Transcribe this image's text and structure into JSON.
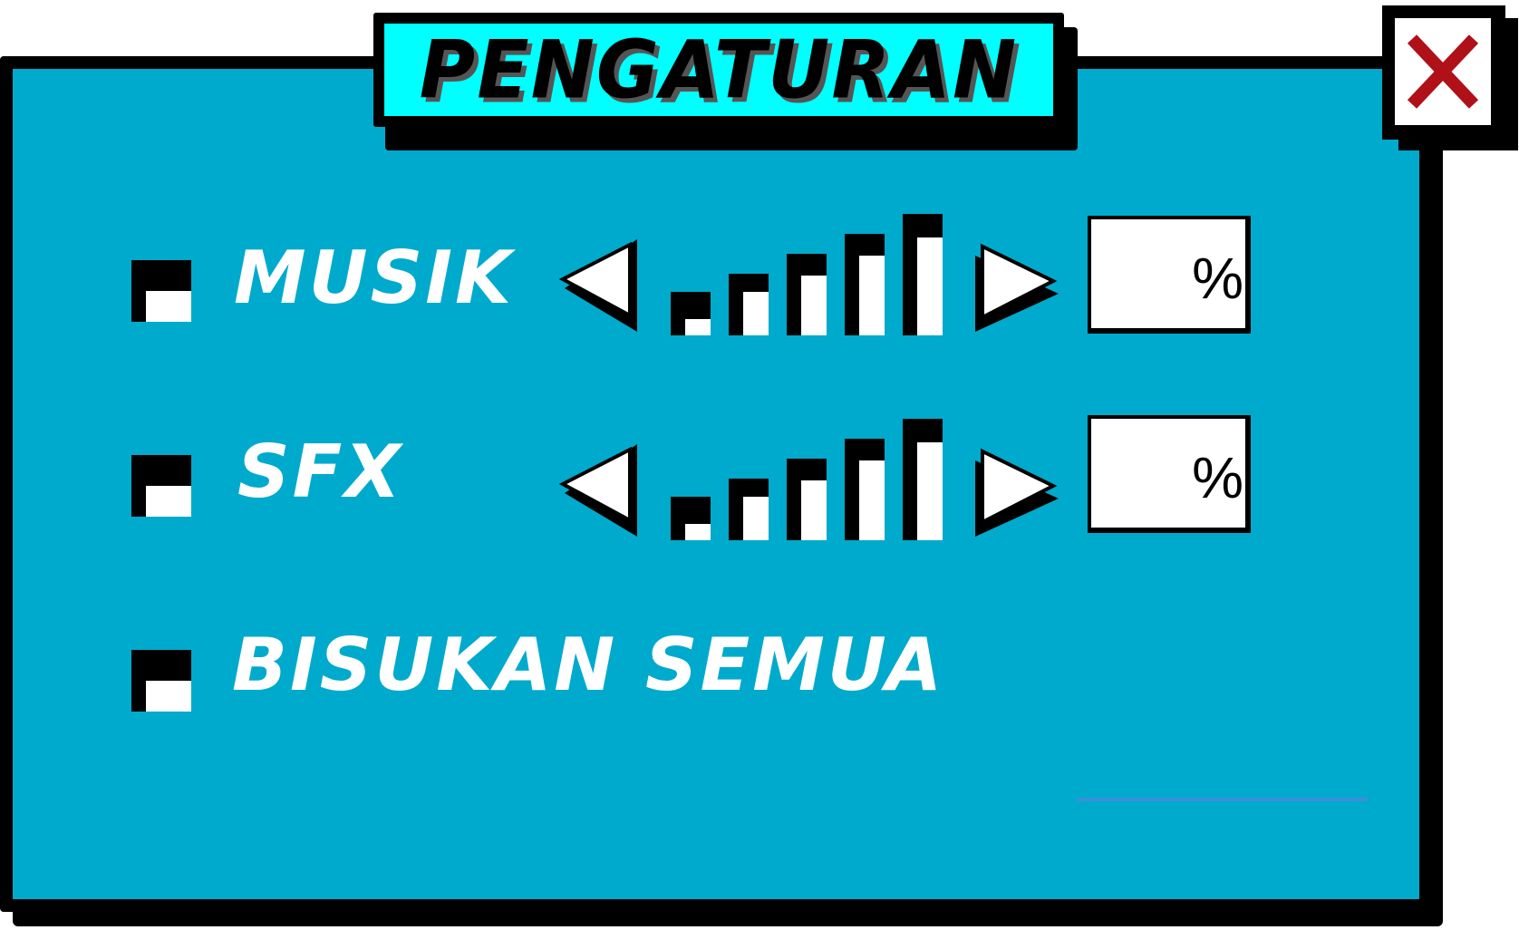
{
  "window": {
    "title": "PENGATURAN",
    "close_icon": "close-x-icon"
  },
  "settings": [
    {
      "id": "musik",
      "label": "MUSIK",
      "has_volume": true,
      "volume_unit": "%",
      "value": ""
    },
    {
      "id": "sfx",
      "label": "SFX",
      "has_volume": true,
      "volume_unit": "%",
      "value": ""
    },
    {
      "id": "mute-all",
      "label": "BISUKAN SEMUA",
      "has_volume": false
    }
  ],
  "colors": {
    "panel": "#00aacc",
    "title_bg": "#00ffff",
    "close_x": "#b01018",
    "outline": "#000000",
    "text": "#ffffff"
  }
}
